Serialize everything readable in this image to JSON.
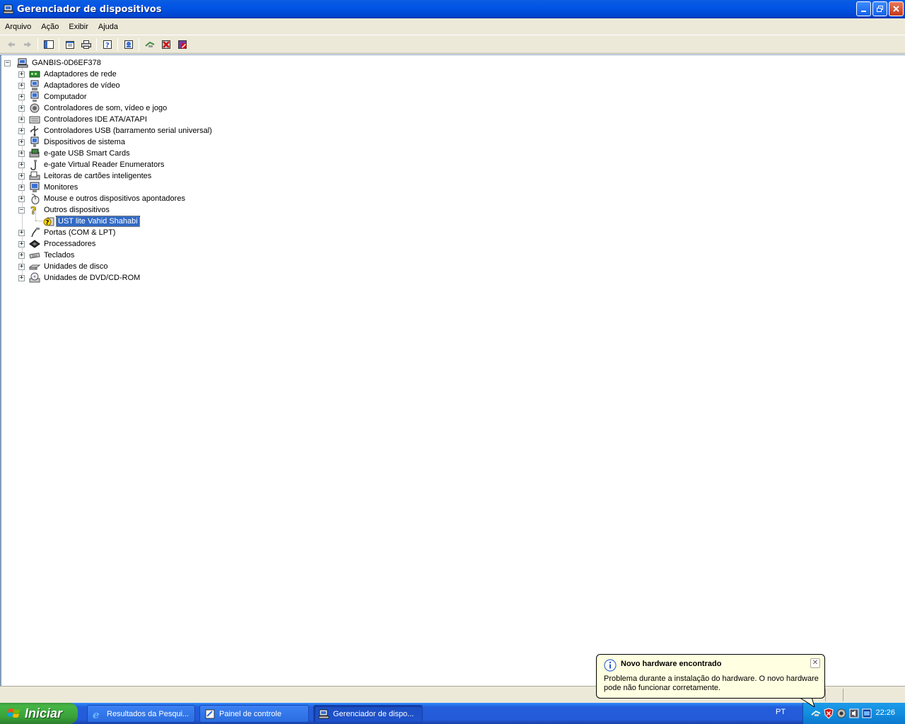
{
  "window": {
    "title": "Gerenciador de dispositivos",
    "icon": "device-manager-icon"
  },
  "menubar": {
    "items": [
      {
        "label": "Arquivo"
      },
      {
        "label": "Ação"
      },
      {
        "label": "Exibir"
      },
      {
        "label": "Ajuda"
      }
    ]
  },
  "toolbar": {
    "buttons": [
      "back-icon",
      "forward-icon",
      "show-hide-tree-icon",
      "properties-icon",
      "print-icon",
      "help-icon",
      "update-driver-icon",
      "scan-hardware-icon",
      "uninstall-icon",
      "disable-icon"
    ]
  },
  "tree": {
    "root": "GANBIS-0D6EF378",
    "categories": [
      {
        "label": "Adaptadores de rede",
        "expanded": false
      },
      {
        "label": "Adaptadores de vídeo",
        "expanded": false
      },
      {
        "label": "Computador",
        "expanded": false
      },
      {
        "label": "Controladores de som, vídeo e jogo",
        "expanded": false
      },
      {
        "label": "Controladores IDE ATA/ATAPI",
        "expanded": false
      },
      {
        "label": "Controladores USB (barramento serial universal)",
        "expanded": false
      },
      {
        "label": "Dispositivos de sistema",
        "expanded": false
      },
      {
        "label": "e-gate USB Smart Cards",
        "expanded": false
      },
      {
        "label": "e-gate Virtual Reader Enumerators",
        "expanded": false
      },
      {
        "label": "Leitoras de cartões inteligentes",
        "expanded": false
      },
      {
        "label": "Monitores",
        "expanded": false
      },
      {
        "label": "Mouse e outros dispositivos apontadores",
        "expanded": false
      },
      {
        "label": "Outros dispositivos",
        "expanded": true,
        "children": [
          {
            "label": "UST lite Vahid Shahabi",
            "selected": true
          }
        ]
      },
      {
        "label": "Portas (COM & LPT)",
        "expanded": false
      },
      {
        "label": "Processadores",
        "expanded": false
      },
      {
        "label": "Teclados",
        "expanded": false
      },
      {
        "label": "Unidades de disco",
        "expanded": false
      },
      {
        "label": "Unidades de DVD/CD-ROM",
        "expanded": false
      }
    ]
  },
  "taskbar": {
    "start_label": "Iniciar",
    "tasks": [
      {
        "label": "Resultados da Pesqui...",
        "icon": "ie-icon",
        "active": false
      },
      {
        "label": "Painel de controle",
        "icon": "control-panel-icon",
        "active": false
      },
      {
        "label": "Gerenciador de dispo...",
        "icon": "device-manager-icon",
        "active": true
      }
    ],
    "language": "PT",
    "clock": "22:26"
  },
  "balloon": {
    "title": "Novo hardware encontrado",
    "body": "Problema durante a instalação do hardware. O novo hardware pode não funcionar corretamente.",
    "close_glyph": "✕"
  }
}
